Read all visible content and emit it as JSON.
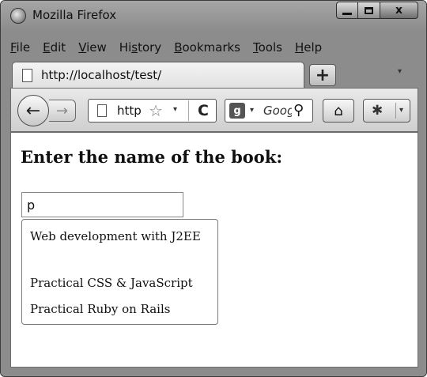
{
  "window": {
    "title": "Mozilla Firefox",
    "minimize_glyph": "",
    "close_glyph": "x"
  },
  "menu": [
    {
      "key": "F",
      "rest": "ile"
    },
    {
      "key": "E",
      "rest": "dit"
    },
    {
      "key": "V",
      "rest": "iew"
    },
    {
      "pre": "Hi",
      "key": "s",
      "rest": "tory"
    },
    {
      "key": "B",
      "rest": "ookmarks"
    },
    {
      "key": "T",
      "rest": "ools"
    },
    {
      "key": "H",
      "rest": "elp"
    }
  ],
  "tab": {
    "title": "http://localhost/test/",
    "new_tab_label": "+",
    "list_glyph": "▾"
  },
  "nav": {
    "back_glyph": "←",
    "forward_glyph": "→",
    "url_text": "http://localhost/test/",
    "star_glyph": "☆",
    "drop_glyph": "▾",
    "reload_glyph": "C",
    "search_engine_glyph": "g",
    "search_placeholder": "Google",
    "search_glyph": "⚲",
    "home_glyph": "⌂",
    "addon_glyph": "✱"
  },
  "page": {
    "heading": "Enter the name of the book:",
    "input_value": "p",
    "suggestions": [
      "Web development with J2EE",
      "Practical CSS & JavaScript",
      "Practical Ruby on Rails"
    ]
  }
}
